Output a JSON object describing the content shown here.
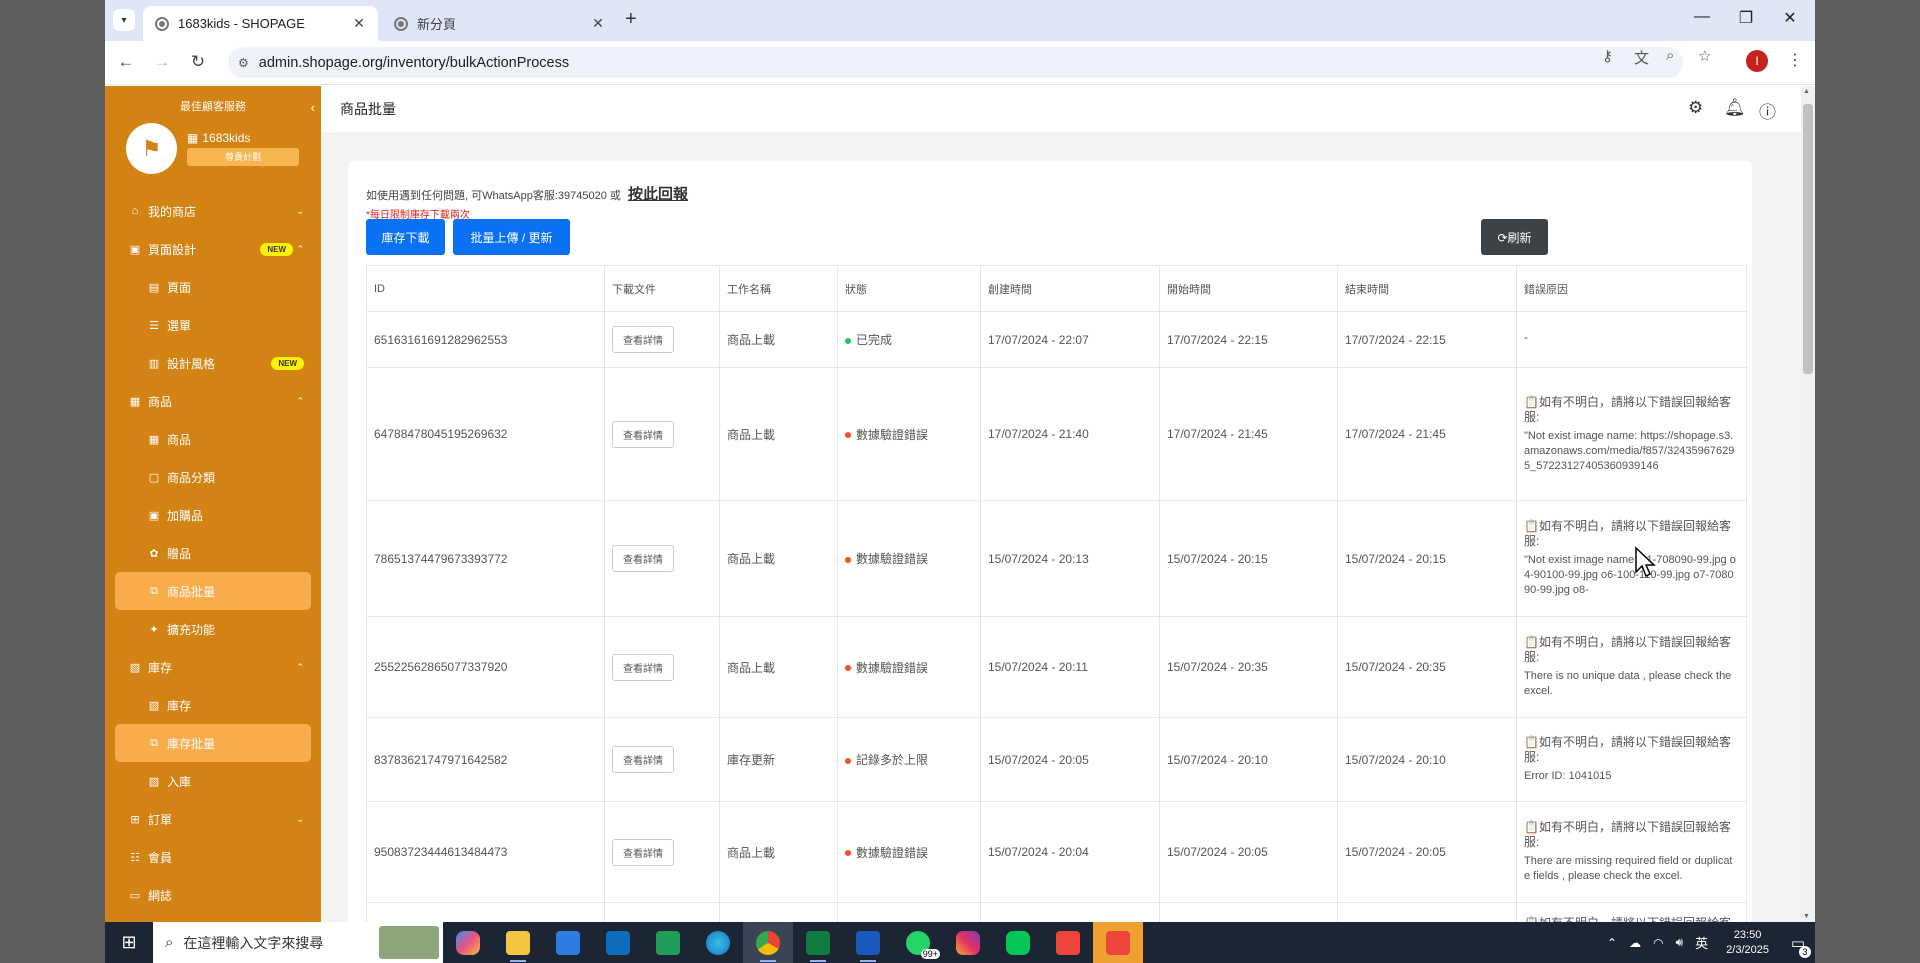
{
  "browser": {
    "active_tab_title": "1683kids - SHOPAGE",
    "inactive_tab_title": "新分頁",
    "url": "admin.shopage.org/inventory/bulkActionProcess",
    "profile_initial": "I"
  },
  "sidebar": {
    "brand": "最佳顧客服務",
    "shop_name": "1683kids",
    "plan": "尊貴計劃",
    "items": [
      {
        "label": "我的商店",
        "icon": "⌂",
        "caret": "⌄"
      },
      {
        "label": "頁面設計",
        "icon": "▣",
        "caret": "⌃",
        "badge": "NEW"
      },
      {
        "label": "頁面",
        "icon": "▤"
      },
      {
        "label": "選單",
        "icon": "☰"
      },
      {
        "label": "設計風格",
        "icon": "▥",
        "badge": "NEW"
      },
      {
        "label": "商品",
        "icon": "▦",
        "caret": "⌃"
      },
      {
        "label": "商品",
        "icon": "▦"
      },
      {
        "label": "商品分類",
        "icon": "▢"
      },
      {
        "label": "加購品",
        "icon": "▣"
      },
      {
        "label": "贈品",
        "icon": "✿"
      },
      {
        "label": "商品批量",
        "icon": "⧉"
      },
      {
        "label": "擴充功能",
        "icon": "✦"
      },
      {
        "label": "庫存",
        "icon": "▧",
        "caret": "⌃"
      },
      {
        "label": "庫存",
        "icon": "▧"
      },
      {
        "label": "庫存批量",
        "icon": "⧉"
      },
      {
        "label": "入庫",
        "icon": "▧"
      },
      {
        "label": "訂單",
        "icon": "⊞",
        "caret": "⌄"
      },
      {
        "label": "會員",
        "icon": "☷"
      },
      {
        "label": "網誌",
        "icon": "▭"
      }
    ]
  },
  "header": {
    "title": "商品批量"
  },
  "content": {
    "hint": "如使用遇到任何問題, 可WhatsApp客服:39745020 或",
    "report_link": "按此回報",
    "limit_note": "*每日限制庫存下載兩次",
    "download_btn": "庫存下載",
    "upload_btn": "批量上傳 / 更新",
    "refresh_btn": "⟳刷新"
  },
  "table": {
    "headers": [
      "ID",
      "下載文件",
      "工作名稱",
      "狀態",
      "創建時間",
      "開始時間",
      "結束時間",
      "錯誤原因"
    ],
    "detail_label": "查看詳情",
    "rows": [
      {
        "id": "65163161691282962553",
        "job": "商品上載",
        "status": "已完成",
        "status_color": "#22c55e",
        "created": "17/07/2024 - 22:07",
        "start": "17/07/2024 - 22:15",
        "end": "17/07/2024 - 22:15",
        "err_head": "-",
        "err_detail": ""
      },
      {
        "id": "64788478045195269632",
        "job": "商品上載",
        "status": "數據驗證錯誤",
        "status_color": "#f4511e",
        "created": "17/07/2024 - 21:40",
        "start": "17/07/2024 - 21:45",
        "end": "17/07/2024 - 21:45",
        "err_head": "📋如有不明白，請將以下錯誤回報給客服:",
        "err_detail": "\"Not exist image name: https://shopage.s3.amazonaws.com/media/f857/324359676295_57223127405360939146"
      },
      {
        "id": "78651374479673393772",
        "job": "商品上載",
        "status": "數據驗證錯誤",
        "status_color": "#f4511e",
        "created": "15/07/2024 - 20:13",
        "start": "15/07/2024 - 20:15",
        "end": "15/07/2024 - 20:15",
        "err_head": "📋如有不明白，請將以下錯誤回報給客服:",
        "err_detail": "\"Not exist image name: o1-708090-99.jpg o4-90100-99.jpg o6-100-110-99.jpg o7-708090-99.jpg o8-"
      },
      {
        "id": "25522562865077337920",
        "job": "商品上載",
        "status": "數據驗證錯誤",
        "status_color": "#f4511e",
        "created": "15/07/2024 - 20:11",
        "start": "15/07/2024 - 20:35",
        "end": "15/07/2024 - 20:35",
        "err_head": "📋如有不明白，請將以下錯誤回報給客服:",
        "err_detail": "There is no unique data , please check the excel."
      },
      {
        "id": "83783621747971642582",
        "job": "庫存更新",
        "status": "記錄多於上限",
        "status_color": "#f4511e",
        "created": "15/07/2024 - 20:05",
        "start": "15/07/2024 - 20:10",
        "end": "15/07/2024 - 20:10",
        "err_head": "📋如有不明白，請將以下錯誤回報給客服:",
        "err_detail": "Error ID: 1041015"
      },
      {
        "id": "95083723444613484473",
        "job": "商品上載",
        "status": "數據驗證錯誤",
        "status_color": "#f4511e",
        "created": "15/07/2024 - 20:04",
        "start": "15/07/2024 - 20:05",
        "end": "15/07/2024 - 20:05",
        "err_head": "📋如有不明白，請將以下錯誤回報給客服:",
        "err_detail": "There are missing required field or duplicate fields , please check the excel."
      },
      {
        "id": "",
        "job": "",
        "status": "",
        "status_color": "#f4511e",
        "created": "",
        "start": "",
        "end": "",
        "err_head": "📋如有不明白，請將以下錯誤回報給客服:",
        "err_detail": ""
      }
    ]
  },
  "taskbar": {
    "search_placeholder": "在這裡輸入文字來搜尋",
    "time": "23:50",
    "date": "2/3/2025",
    "ime": "英",
    "badge": "99+",
    "notif_count": "3"
  }
}
